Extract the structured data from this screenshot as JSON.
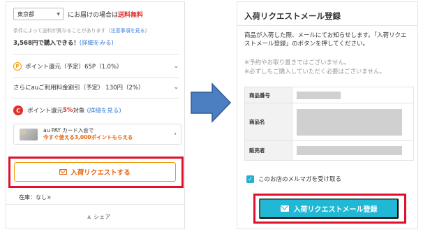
{
  "left": {
    "prefecture": "東京都",
    "ship_prefix": "にお届けの場合は",
    "ship_free": "送料無料",
    "note_text": "条件によって送料が異なることがあります",
    "note_link": "（注意事項を見る）",
    "cond_text": "3,568円で購入できる！",
    "cond_link": "(詳細をみる)",
    "point_icon": "P",
    "point_row1": "ポイント還元（予定）65P（1.0%）",
    "point_row2": "さらにauご利用料金割引（予定） 130円（2%）",
    "campaign_icon": "C",
    "campaign_prefix": "ポイント還元",
    "campaign_pct": "5%",
    "campaign_suffix": "対象",
    "campaign_link": "(詳細を見る)",
    "card_line1": "au PAY カード入会で",
    "card_line2": "今すぐ使える3,000ポイントもらえる",
    "request_button": "入荷リクエストする",
    "stock": "在庫：なし×",
    "share": "シェア"
  },
  "right": {
    "title": "入荷リクエストメール登録",
    "desc": "商品が入荷した際、メールにてお知らせします。「入荷リクエストメール登録」のボタンを押してください。",
    "note1": "※予約やお取り置きではございません。",
    "note2": "※必ずしもご購入していただく必要はございません。",
    "table": [
      {
        "label": "商品番号"
      },
      {
        "label": "商品名"
      },
      {
        "label": "販売者"
      }
    ],
    "newsletter_label": "このお店のメルマガを受け取る",
    "register_button": "入荷リクエストメール登録"
  },
  "colors": {
    "accent_orange": "#e8620c",
    "accent_teal": "#20b8d4",
    "highlight_red": "#e0102a",
    "arrow_blue": "#4a7fc1"
  }
}
